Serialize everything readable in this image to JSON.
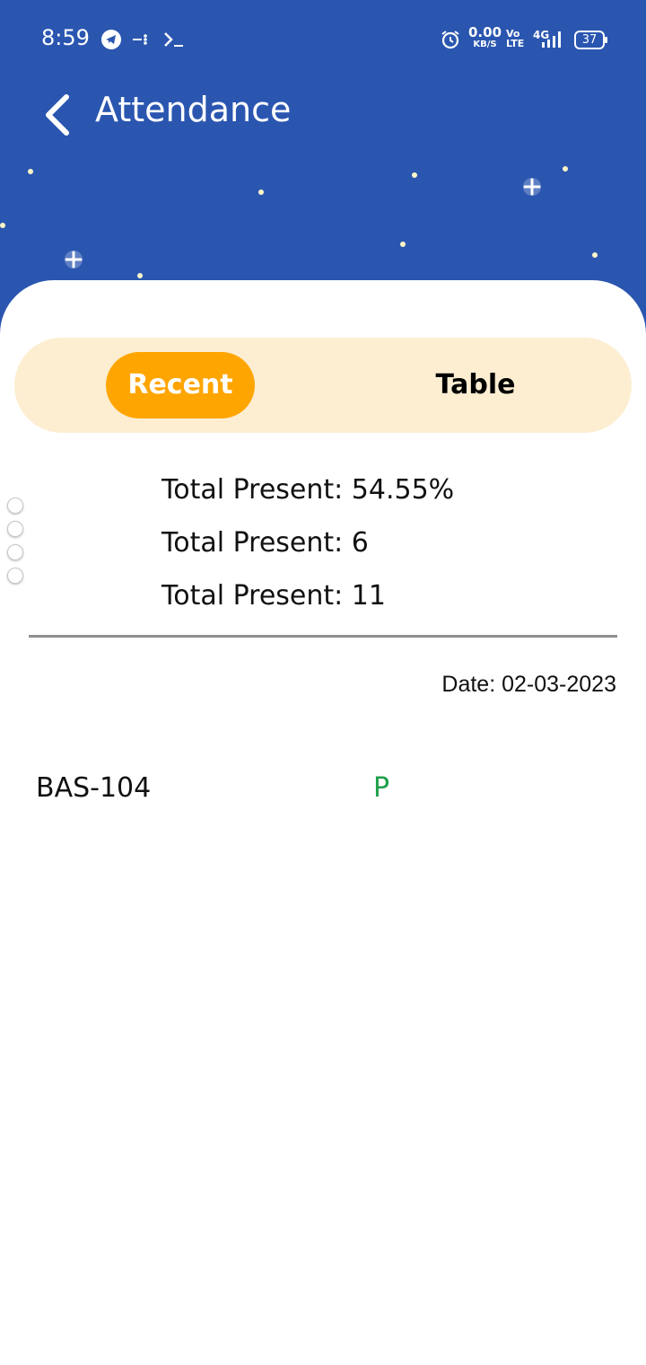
{
  "status_bar": {
    "time": "8:59",
    "net_speed_value": "0.00",
    "net_speed_unit": "KB/S",
    "volte_top": "Vo",
    "volte_bottom": "LTE",
    "network": "4G",
    "battery": "37"
  },
  "header": {
    "title": "Attendance"
  },
  "tabs": {
    "recent_label": "Recent",
    "table_label": "Table",
    "active": "Recent"
  },
  "summary": {
    "line1": "Total Present: 54.55%",
    "line2": "Total Present: 6",
    "line3": "Total Present: 11"
  },
  "record": {
    "date": "Date: 02-03-2023",
    "course": "BAS-104",
    "status": "P",
    "status_color": "#1ea04a"
  },
  "colors": {
    "header_bg": "#2a56b0",
    "accent": "#ffa500",
    "segment_bg": "#fdeed2"
  }
}
